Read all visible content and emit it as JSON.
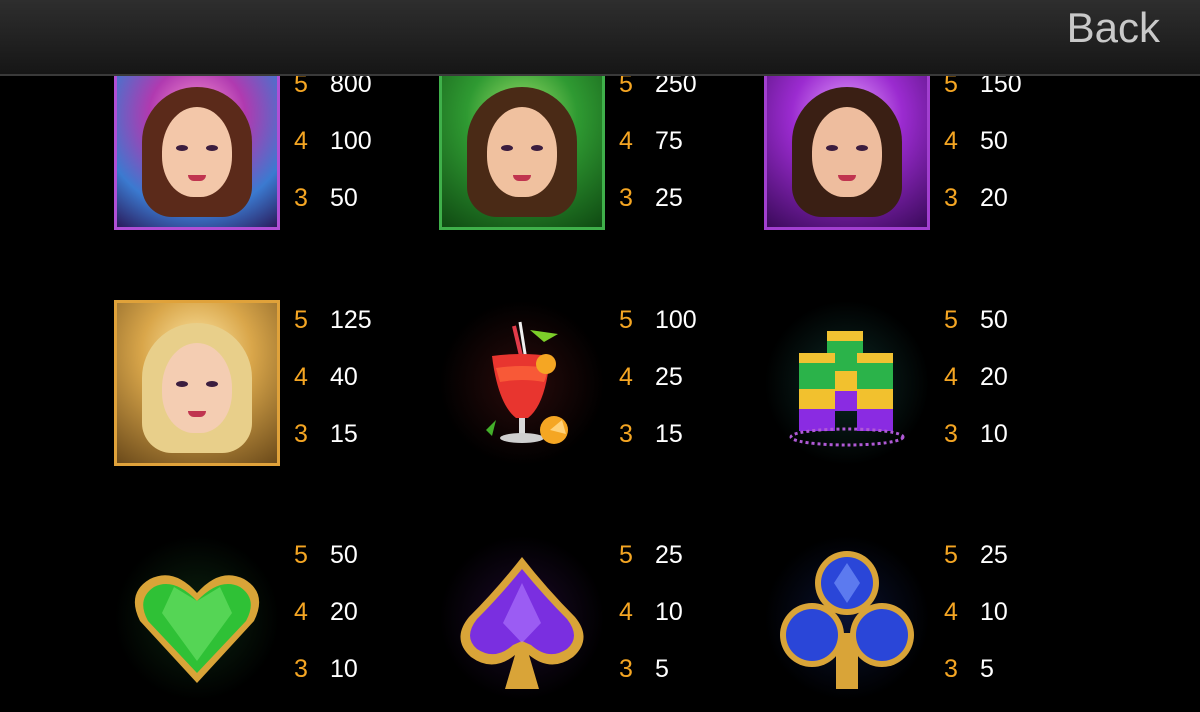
{
  "header": {
    "back_label": "Back"
  },
  "colors": {
    "count": "#f5a623",
    "value": "#ffffff",
    "bar": "#1e1e1e"
  },
  "symbols": [
    {
      "name": "dancer-orange",
      "icon": "carnival-dancer-orange-icon",
      "pays": [
        {
          "count": "5",
          "value": "800"
        },
        {
          "count": "4",
          "value": "100"
        },
        {
          "count": "3",
          "value": "50"
        }
      ]
    },
    {
      "name": "dancer-green",
      "icon": "carnival-dancer-green-icon",
      "pays": [
        {
          "count": "5",
          "value": "250"
        },
        {
          "count": "4",
          "value": "75"
        },
        {
          "count": "3",
          "value": "25"
        }
      ]
    },
    {
      "name": "dancer-purple",
      "icon": "carnival-dancer-purple-icon",
      "pays": [
        {
          "count": "5",
          "value": "150"
        },
        {
          "count": "4",
          "value": "50"
        },
        {
          "count": "3",
          "value": "20"
        }
      ]
    },
    {
      "name": "dancer-gold",
      "icon": "carnival-dancer-gold-icon",
      "pays": [
        {
          "count": "5",
          "value": "125"
        },
        {
          "count": "4",
          "value": "40"
        },
        {
          "count": "3",
          "value": "15"
        }
      ]
    },
    {
      "name": "cocktail",
      "icon": "cocktail-icon",
      "pays": [
        {
          "count": "5",
          "value": "100"
        },
        {
          "count": "4",
          "value": "25"
        },
        {
          "count": "3",
          "value": "15"
        }
      ]
    },
    {
      "name": "shots",
      "icon": "shot-glasses-icon",
      "pays": [
        {
          "count": "5",
          "value": "50"
        },
        {
          "count": "4",
          "value": "20"
        },
        {
          "count": "3",
          "value": "10"
        }
      ]
    },
    {
      "name": "heart",
      "icon": "green-heart-gem-icon",
      "pays": [
        {
          "count": "5",
          "value": "50"
        },
        {
          "count": "4",
          "value": "20"
        },
        {
          "count": "3",
          "value": "10"
        }
      ]
    },
    {
      "name": "spade",
      "icon": "purple-spade-gem-icon",
      "pays": [
        {
          "count": "5",
          "value": "25"
        },
        {
          "count": "4",
          "value": "10"
        },
        {
          "count": "3",
          "value": "5"
        }
      ]
    },
    {
      "name": "club",
      "icon": "blue-club-gem-icon",
      "pays": [
        {
          "count": "5",
          "value": "25"
        },
        {
          "count": "4",
          "value": "10"
        },
        {
          "count": "3",
          "value": "5"
        }
      ]
    }
  ]
}
